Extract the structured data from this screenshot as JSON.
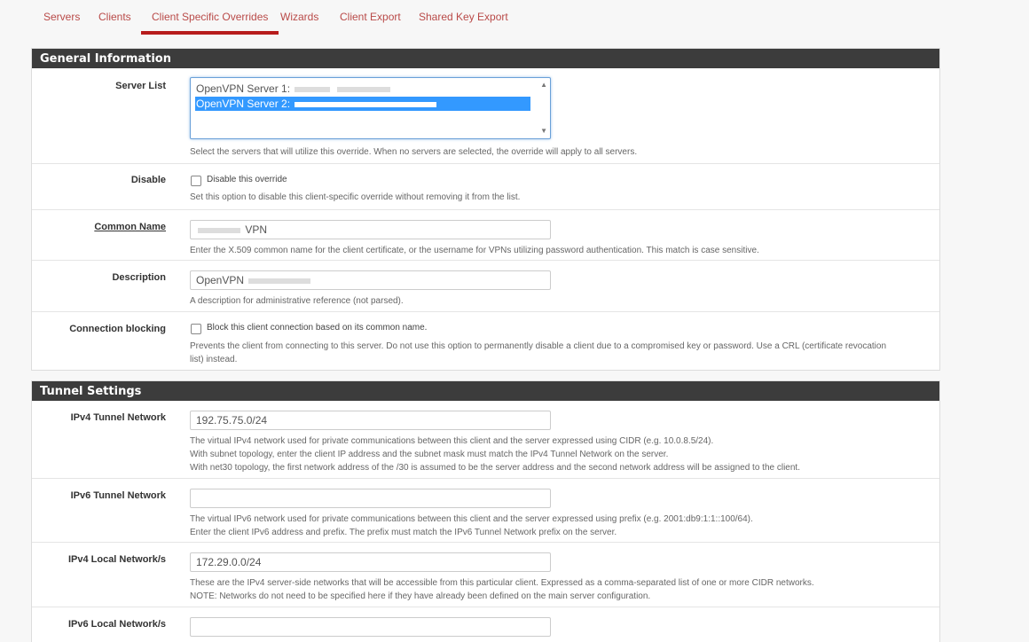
{
  "tabs": [
    {
      "label": "Servers",
      "active": false
    },
    {
      "label": "Clients",
      "active": false
    },
    {
      "label": "Client Specific Overrides",
      "active": true
    },
    {
      "label": "Wizards",
      "active": false
    },
    {
      "label": "Client Export",
      "active": false
    },
    {
      "label": "Shared Key Export",
      "active": false
    }
  ],
  "general": {
    "heading": "General Information",
    "server_list": {
      "label": "Server List",
      "options": [
        "OpenVPN Server 1:",
        "OpenVPN Server 2:"
      ],
      "selected_index": 1,
      "help": "Select the servers that will utilize this override. When no servers are selected, the override will apply to all servers."
    },
    "disable": {
      "label": "Disable",
      "checkbox_label": "Disable this override",
      "checked": false,
      "help": "Set this option to disable this client-specific override without removing it from the list."
    },
    "common_name": {
      "label": "Common Name",
      "value_visible": "VPN",
      "help": "Enter the X.509 common name for the client certificate, or the username for VPNs utilizing password authentication. This match is case sensitive."
    },
    "description": {
      "label": "Description",
      "value_visible": "OpenVPN",
      "help": "A description for administrative reference (not parsed)."
    },
    "connection_blocking": {
      "label": "Connection blocking",
      "checkbox_label": "Block this client connection based on its common name.",
      "checked": false,
      "help": "Prevents the client from connecting to this server. Do not use this option to permanently disable a client due to a compromised key or password. Use a CRL (certificate revocation list) instead."
    }
  },
  "tunnel": {
    "heading": "Tunnel Settings",
    "ipv4_tunnel": {
      "label": "IPv4 Tunnel Network",
      "value": "192.75.75.0/24",
      "help": [
        "The virtual IPv4 network used for private communications between this client and the server expressed using CIDR (e.g. 10.0.8.5/24).",
        "With subnet topology, enter the client IP address and the subnet mask must match the IPv4 Tunnel Network on the server.",
        "With net30 topology, the first network address of the /30 is assumed to be the server address and the second network address will be assigned to the client."
      ]
    },
    "ipv6_tunnel": {
      "label": "IPv6 Tunnel Network",
      "value": "",
      "help": [
        "The virtual IPv6 network used for private communications between this client and the server expressed using prefix (e.g. 2001:db9:1:1::100/64).",
        "Enter the client IPv6 address and prefix. The prefix must match the IPv6 Tunnel Network prefix on the server."
      ]
    },
    "ipv4_local": {
      "label": "IPv4 Local Network/s",
      "value": "172.29.0.0/24",
      "help": [
        "These are the IPv4 server-side networks that will be accessible from this particular client. Expressed as a comma-separated list of one or more CIDR networks.",
        "NOTE: Networks do not need to be specified here if they have already been defined on the main server configuration."
      ]
    },
    "ipv6_local": {
      "label": "IPv6 Local Network/s",
      "value": ""
    }
  }
}
